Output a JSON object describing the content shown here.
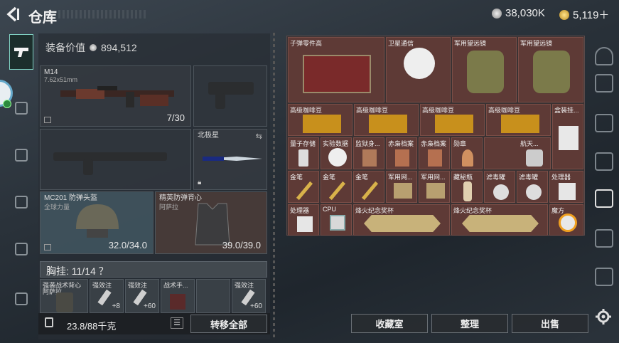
{
  "header": {
    "title": "仓库"
  },
  "currency": {
    "silver": "38,030K",
    "gold": "5,119＋"
  },
  "equipment": {
    "value_label": "装备价值",
    "value": "894,512",
    "primary_weapon": {
      "name": "M14",
      "caliber": "7.62x51mm",
      "ammo": "7/30"
    },
    "sidearm_slot": {
      "name": ""
    },
    "secondary_weapon": {
      "name": ""
    },
    "melee": {
      "name": "北极星"
    },
    "helmet": {
      "name": "MC201 防弹头盔",
      "sub": "全球力量",
      "durability": "32.0/34.0"
    },
    "armor": {
      "name": "精英防弹背心",
      "sub": "阿萨拉",
      "durability": "39.0/39.0"
    },
    "chest_rig": {
      "label": "胸挂: 11/14 ？"
    },
    "chest_items": [
      {
        "name": "强袭战术背心",
        "sub": "阿萨拉",
        "count": ""
      },
      {
        "name": "强效注",
        "count": "+8"
      },
      {
        "name": "强效注",
        "count": "+60"
      },
      {
        "name": "战术手...",
        "count": ""
      },
      {
        "name": "",
        "count": ""
      },
      {
        "name": "强效注",
        "count": "+60"
      }
    ],
    "weight": "23.8/88千克",
    "transfer_all": "转移全部"
  },
  "storage": {
    "items": [
      {
        "name": "子弹零件高"
      },
      {
        "name": "卫星通信"
      },
      {
        "name": "军用望远镜"
      },
      {
        "name": "军用望远镜"
      },
      {
        "name": "高级咖啡豆"
      },
      {
        "name": "高级咖啡豆"
      },
      {
        "name": "高级咖啡豆"
      },
      {
        "name": "高级咖啡豆"
      },
      {
        "name": "盒装挂..."
      },
      {
        "name": "量子存储"
      },
      {
        "name": "实验数据"
      },
      {
        "name": "监狱身..."
      },
      {
        "name": "赤枭档案"
      },
      {
        "name": "赤枭档案"
      },
      {
        "name": "勋章"
      },
      {
        "name": "航天..."
      },
      {
        "name": "金笔"
      },
      {
        "name": "金笔"
      },
      {
        "name": "金笔"
      },
      {
        "name": "军用网..."
      },
      {
        "name": "军用网..."
      },
      {
        "name": "藏秘瓶"
      },
      {
        "name": "滤毒罐"
      },
      {
        "name": "滤毒罐"
      },
      {
        "name": "处理器"
      },
      {
        "name": "处理器"
      },
      {
        "name": "CPU"
      },
      {
        "name": "烽火纪念奖杯"
      },
      {
        "name": "烽火纪念奖杯"
      },
      {
        "name": "魔方"
      }
    ]
  },
  "actions": {
    "vault": "收藏室",
    "sort": "整理",
    "sell": "出售"
  }
}
